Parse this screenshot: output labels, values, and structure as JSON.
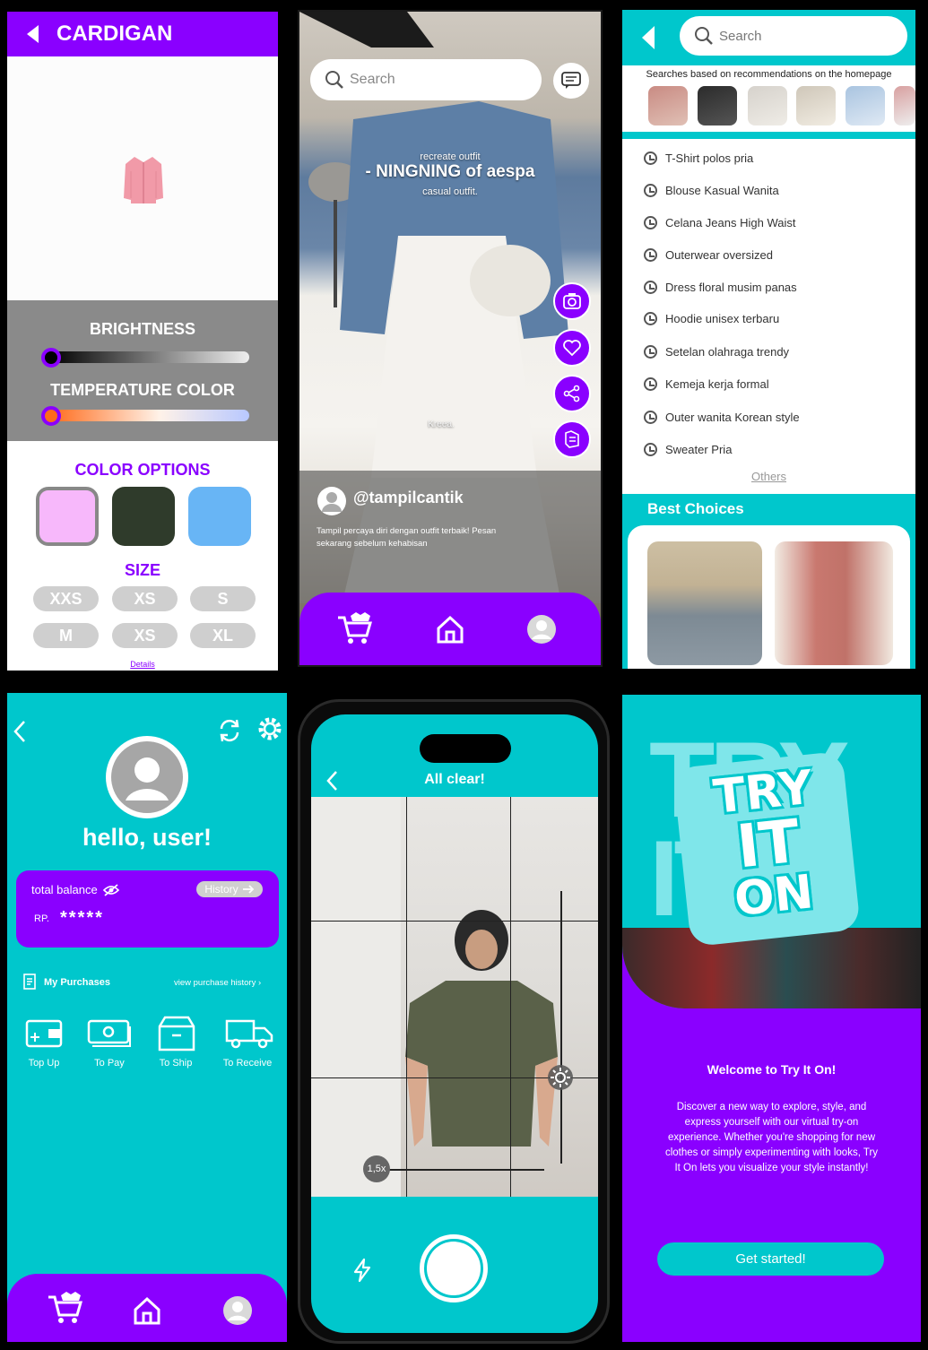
{
  "colors": {
    "purple": "#8a00ff",
    "teal": "#00c7cc"
  },
  "panel1": {
    "title": "CARDIGAN",
    "brightness_label": "BRIGHTNESS",
    "brightness_level": 0,
    "temperature_label": "TEMPERATURE COLOR",
    "temperature_level": 0,
    "color_options_label": "COLOR OPTIONS",
    "swatches": [
      "#f7b8fb",
      "#2f3b2b",
      "#68b5f5"
    ],
    "selected_swatch": 0,
    "size_label": "SIZE",
    "sizes": [
      "XXS",
      "XS",
      "S",
      "M",
      "XS",
      "XL"
    ],
    "details_link": "Details"
  },
  "panel2": {
    "search_placeholder": "Search",
    "overlay_small": "recreate outfit",
    "overlay_big": "- NINGNING of aespa",
    "overlay_small2": "casual outfit.",
    "watermark": "Kreea.",
    "username": "@tampilcantik",
    "caption": "Tampil percaya diri dengan outfit terbaik! Pesan sekarang sebelum kehabisan"
  },
  "panel3": {
    "search_placeholder": "Search",
    "rec_label": "Searches based on recommendations on the homepage",
    "history": [
      "T-Shirt polos pria",
      "Blouse Kasual Wanita",
      "Celana Jeans High Waist",
      "Outerwear oversized",
      "Dress floral musim panas",
      "Hoodie unisex terbaru",
      "Setelan olahraga trendy",
      "Kemeja kerja formal",
      "Outer wanita Korean style",
      "Sweater Pria"
    ],
    "others_link": "Others",
    "best_label": "Best Choices"
  },
  "panel4": {
    "greeting": "hello, user!",
    "balance_label": "total balance",
    "history_btn": "History",
    "currency": "RP.",
    "masked_amount": "*****",
    "purchases_label": "My Purchases",
    "view_history": "view purchase history",
    "actions": [
      "Top Up",
      "To Pay",
      "To Ship",
      "To Receive"
    ]
  },
  "panel5": {
    "title": "All clear!",
    "zoom": "1,5x"
  },
  "panel6": {
    "logo_lines": [
      "TRY",
      "IT",
      "ON"
    ],
    "welcome": "Welcome to Try It On!",
    "description": "Discover a new way to explore, style, and express yourself with our virtual try-on experience. Whether you're shopping for new clothes or simply experimenting with looks, Try It On lets you visualize your style instantly!",
    "cta": "Get started!"
  }
}
